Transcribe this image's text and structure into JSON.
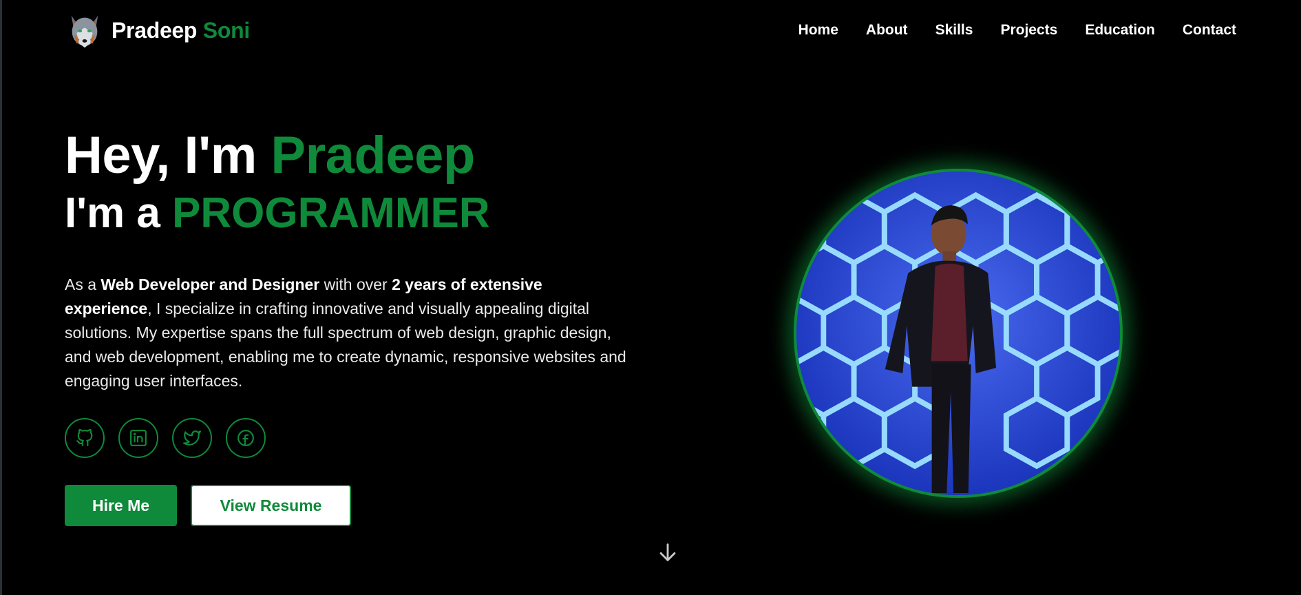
{
  "brand": {
    "first": "Pradeep",
    "last": "Soni",
    "logo_icon": "wolf-logo-icon"
  },
  "nav": {
    "items": [
      "Home",
      "About",
      "Skills",
      "Projects",
      "Education",
      "Contact"
    ]
  },
  "hero": {
    "greeting": "Hey, I'm",
    "name": "Pradeep",
    "role_prefix": "I'm a",
    "role": "PROGRAMMER",
    "desc": {
      "p1": "As a ",
      "b1": "Web Developer and Designer",
      "p2": " with over ",
      "b2": "2 years of extensive experience",
      "p3": ", I specialize in crafting innovative and visually appealing digital solutions. My expertise spans the full spectrum of web design, graphic design, and web development, enabling me to create dynamic, responsive websites and engaging user interfaces."
    },
    "socials": [
      "github-icon",
      "linkedin-icon",
      "twitter-icon",
      "facebook-icon"
    ],
    "hire_label": "Hire Me",
    "resume_label": "View Resume"
  },
  "colors": {
    "accent": "#0f8a3a",
    "background": "#000000",
    "text": "#ffffff"
  }
}
